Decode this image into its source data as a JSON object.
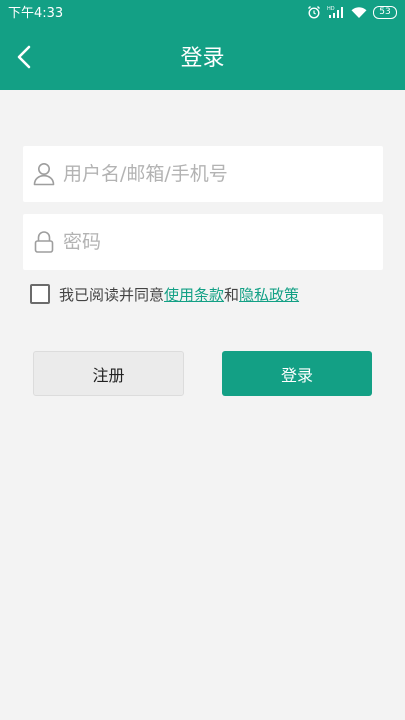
{
  "status_bar": {
    "time": "下午4:33",
    "battery": "53",
    "icons": [
      "alarm-icon",
      "hd-signal-icon",
      "wifi-icon",
      "battery-icon"
    ]
  },
  "app_bar": {
    "title": "登录",
    "back_icon": "chevron-left-icon"
  },
  "form": {
    "username": {
      "placeholder": "用户名/邮箱/手机号",
      "value": "",
      "icon": "user-icon"
    },
    "password": {
      "placeholder": "密码",
      "value": "",
      "icon": "lock-icon"
    },
    "agreement": {
      "checked": false,
      "prefix": "我已阅读并同意",
      "terms_link": "使用条款",
      "connector": "和",
      "privacy_link": "隐私政策"
    }
  },
  "buttons": {
    "register": "注册",
    "login": "登录"
  },
  "colors": {
    "primary": "#13a085",
    "background": "#f3f3f3",
    "register_button": "#ebebeb"
  }
}
